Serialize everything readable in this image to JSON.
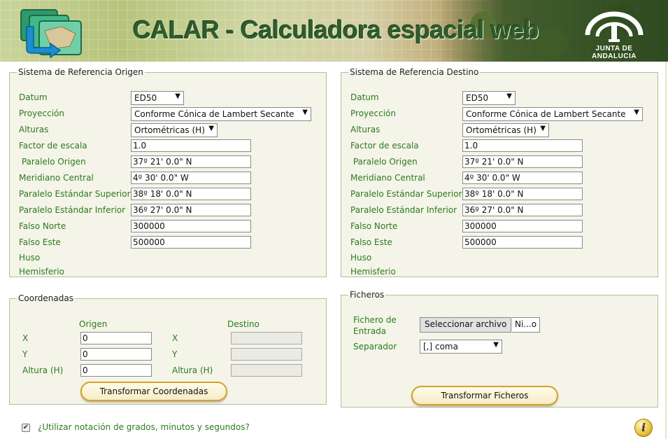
{
  "header": {
    "title": "CALAR - Calculadora espacial web",
    "logo_org": "JUNTA DE ANDALUCIA"
  },
  "origin": {
    "legend": "Sistema de Referencia Origen",
    "labels": {
      "datum": "Datum",
      "proyeccion": "Proyección",
      "alturas": "Alturas",
      "factor": "Factor de escala",
      "paralelo_origen": " Paralelo Origen",
      "meridiano": "Meridiano Central",
      "std_sup": "Paralelo Estándar Superior",
      "std_inf": "Paralelo Estándar Inferior",
      "falso_norte": "Falso Norte",
      "falso_este": "Falso Este",
      "huso": "Huso",
      "hemisferio": "Hemisferio"
    },
    "values": {
      "datum": "ED50",
      "proyeccion": "Conforme Cónica de Lambert Secante",
      "alturas": "Ortométricas (H)",
      "factor": "1.0",
      "paralelo_origen": "37º 21' 0.0\" N",
      "meridiano": "4º 30' 0.0\" W",
      "std_sup": "38º 18' 0.0\" N",
      "std_inf": "36º 27' 0.0\" N",
      "falso_norte": "300000",
      "falso_este": "500000"
    }
  },
  "destination": {
    "legend": "Sistema de Referencia Destino",
    "labels": {
      "datum": "Datum",
      "proyeccion": "Proyección",
      "alturas": "Alturas",
      "factor": "Factor de escala",
      "paralelo_origen": " Paralelo Origen",
      "meridiano": "Meridiano Central",
      "std_sup": "Paralelo Estándar Superior",
      "std_inf": "Paralelo Estándar Inferior",
      "falso_norte": "Falso Norte",
      "falso_este": "Falso Este",
      "huso": "Huso",
      "hemisferio": "Hemisferio"
    },
    "values": {
      "datum": "ED50",
      "proyeccion": "Conforme Cónica de Lambert Secante",
      "alturas": "Ortométricas (H)",
      "factor": "1.0",
      "paralelo_origen": "37º 21' 0.0\" N",
      "meridiano": "4º 30' 0.0\" W",
      "std_sup": "38º 18' 0.0\" N",
      "std_inf": "36º 27' 0.0\" N",
      "falso_norte": "300000",
      "falso_este": "500000"
    }
  },
  "coords": {
    "legend": "Coordenadas",
    "origen_header": "Origen",
    "destino_header": "Destino",
    "x_label": "X",
    "y_label": "Y",
    "h_label": "Altura (H)",
    "x_value": "0",
    "y_value": "0",
    "h_value": "0",
    "button": "Transformar Coordenadas"
  },
  "files": {
    "legend": "Ficheros",
    "entrada_label_1": "Fichero de",
    "entrada_label_2": "Entrada",
    "select_file_button": "Seleccionar archivo",
    "file_name": "Ni...o",
    "separador_label": "Separador",
    "separador_value": "[,] coma",
    "button": "Transformar Ficheros"
  },
  "footer": {
    "dms_label": "¿Utilizar notación de grados, minutos y segundos?",
    "dms_checked": true,
    "info_glyph": "i"
  },
  "icons": {
    "dropdown": "▼",
    "check": "✔"
  },
  "colors": {
    "label_green": "#2c7a1f",
    "panel_bg": "#f4f4e8",
    "button_border": "#d7a12a"
  }
}
